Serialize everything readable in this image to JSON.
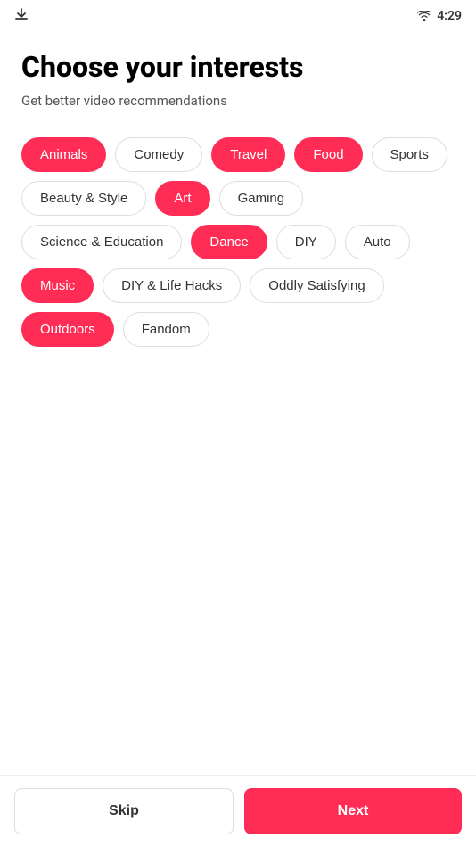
{
  "statusBar": {
    "time": "4:29"
  },
  "page": {
    "title": "Choose your interests",
    "subtitle": "Get better video recommendations"
  },
  "tags": [
    {
      "id": "animals",
      "label": "Animals",
      "active": true
    },
    {
      "id": "comedy",
      "label": "Comedy",
      "active": false
    },
    {
      "id": "travel",
      "label": "Travel",
      "active": true
    },
    {
      "id": "food",
      "label": "Food",
      "active": true
    },
    {
      "id": "sports",
      "label": "Sports",
      "active": false
    },
    {
      "id": "beauty-style",
      "label": "Beauty & Style",
      "active": false
    },
    {
      "id": "art",
      "label": "Art",
      "active": true
    },
    {
      "id": "gaming",
      "label": "Gaming",
      "active": false
    },
    {
      "id": "science-education",
      "label": "Science & Education",
      "active": false
    },
    {
      "id": "dance",
      "label": "Dance",
      "active": true
    },
    {
      "id": "diy",
      "label": "DIY",
      "active": false
    },
    {
      "id": "auto",
      "label": "Auto",
      "active": false
    },
    {
      "id": "music",
      "label": "Music",
      "active": true
    },
    {
      "id": "diy-life-hacks",
      "label": "DIY & Life Hacks",
      "active": false
    },
    {
      "id": "oddly-satisfying",
      "label": "Oddly Satisfying",
      "active": false
    },
    {
      "id": "outdoors",
      "label": "Outdoors",
      "active": true
    },
    {
      "id": "fandom",
      "label": "Fandom",
      "active": false
    }
  ],
  "buttons": {
    "skip": "Skip",
    "next": "Next"
  },
  "colors": {
    "accent": "#ff2d55"
  }
}
